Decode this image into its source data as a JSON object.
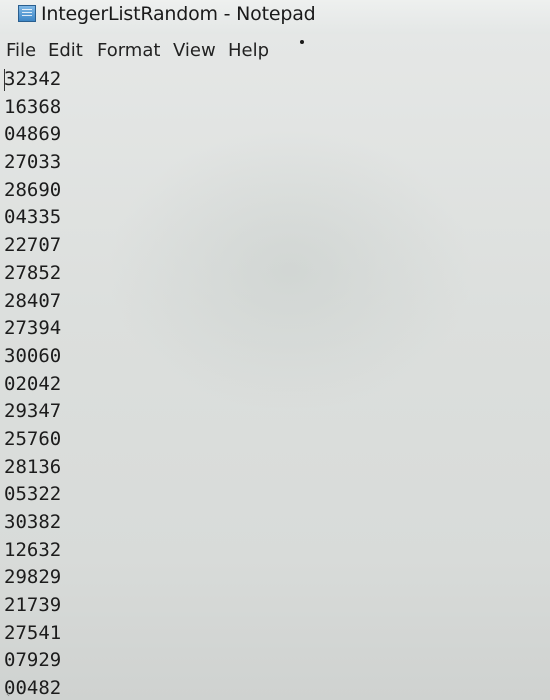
{
  "window": {
    "title": "IntegerListRandom - Notepad"
  },
  "menu": {
    "file": "File",
    "edit": "Edit",
    "format": "Format",
    "view": "View",
    "help": "Help"
  },
  "editor": {
    "lines": [
      "32342",
      "16368",
      "04869",
      "27033",
      "28690",
      "04335",
      "22707",
      "27852",
      "28407",
      "27394",
      "30060",
      "02042",
      "29347",
      "25760",
      "28136",
      "05322",
      "30382",
      "12632",
      "29829",
      "21739",
      "27541",
      "07929",
      "00482"
    ]
  },
  "icons": {
    "app": "notepad-icon"
  }
}
